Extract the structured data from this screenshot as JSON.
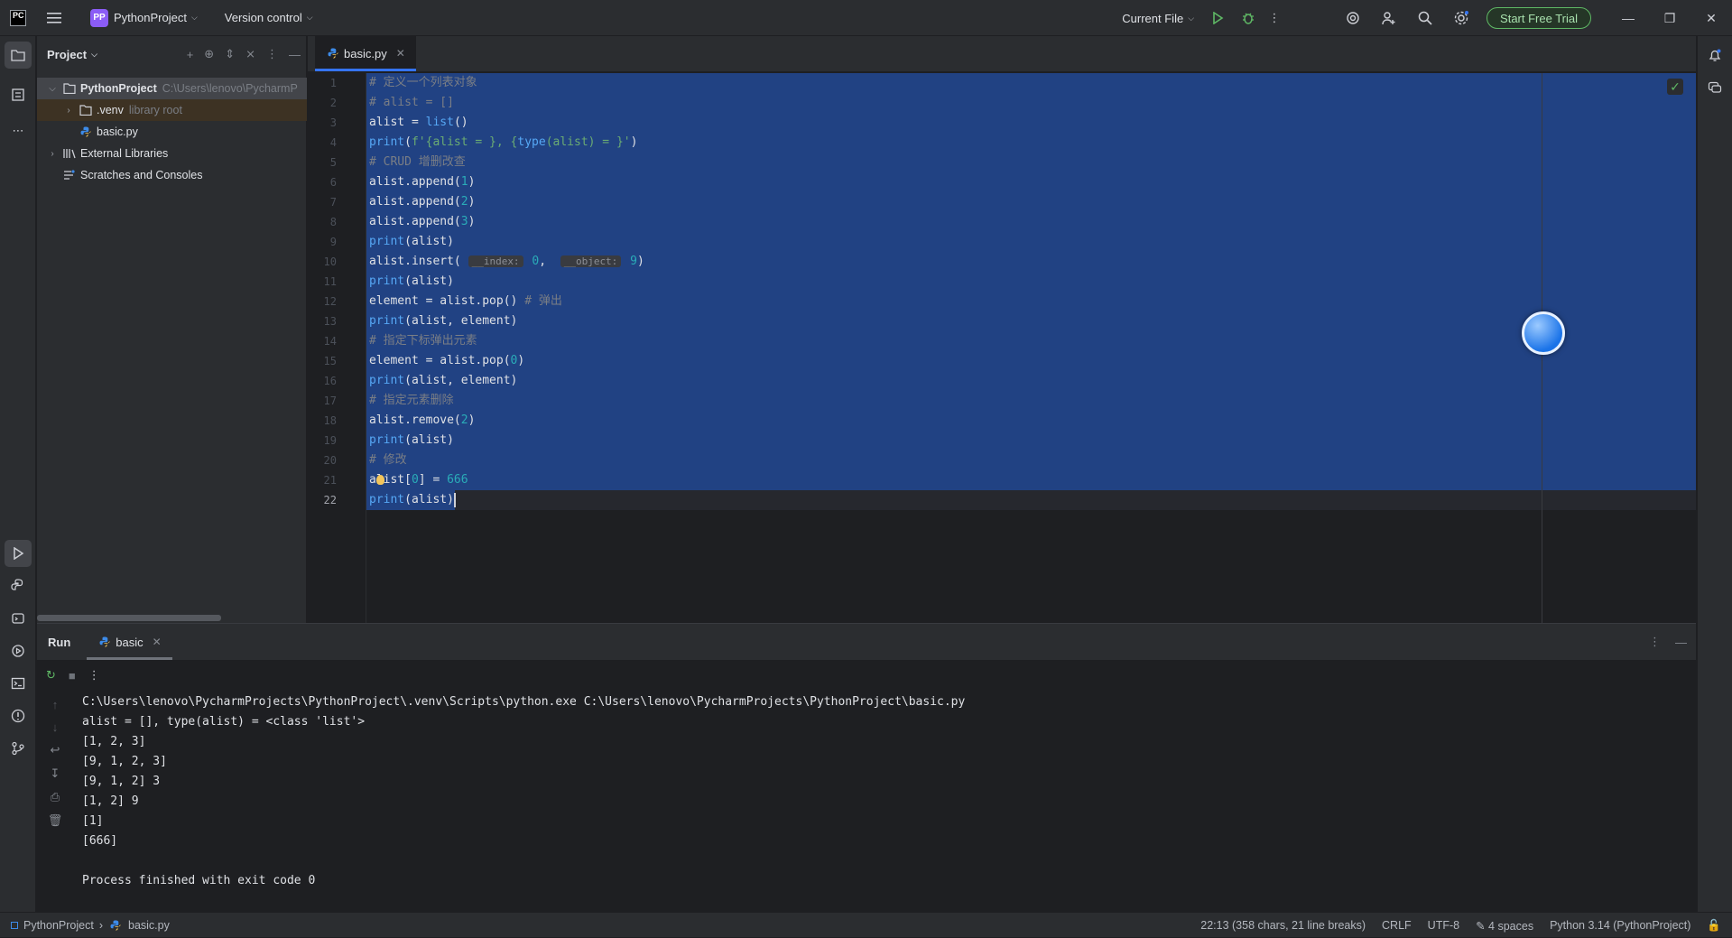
{
  "titlebar": {
    "app_logo": "PC",
    "project_badge": "PP",
    "project_name": "PythonProject",
    "vcs_label": "Version control",
    "run_config": "Current File",
    "trial_button": "Start Free Trial"
  },
  "project_pane": {
    "title": "Project",
    "tree": [
      {
        "label": "PythonProject",
        "hint": "C:\\Users\\lenovo\\PycharmP",
        "icon": "folder-icon",
        "indent": 0,
        "expanded": true
      },
      {
        "label": ".venv",
        "hint": "library root",
        "icon": "folder-icon",
        "indent": 1,
        "expanded": false
      },
      {
        "label": "basic.py",
        "hint": "",
        "icon": "python-file-icon",
        "indent": 1
      },
      {
        "label": "External Libraries",
        "hint": "",
        "icon": "library-icon",
        "indent": 0,
        "expanded": false
      },
      {
        "label": "Scratches and Consoles",
        "hint": "",
        "icon": "scratches-icon",
        "indent": 0
      }
    ]
  },
  "editor": {
    "tab_label": "basic.py",
    "current_line": 22,
    "lines": [
      "# 定义一个列表对象",
      "# alist = []",
      "alist = list()",
      "print(f'{alist = }, {type(alist) = }')",
      "# CRUD 增删改查",
      "alist.append(1)",
      "alist.append(2)",
      "alist.append(3)",
      "print(alist)",
      "alist.insert( __index: 0,  __object: 9)",
      "print(alist)",
      "element = alist.pop() # 弹出",
      "print(alist, element)",
      "# 指定下标弹出元素",
      "element = alist.pop(0)",
      "print(alist, element)",
      "# 指定元素删除",
      "alist.remove(2)",
      "print(alist)",
      "# 修改",
      "alist[0] = 666",
      "print(alist)"
    ],
    "inlay_index": "__index:",
    "inlay_object": "__object:"
  },
  "run_window": {
    "title": "Run",
    "tab_label": "basic",
    "console": [
      "C:\\Users\\lenovo\\PycharmProjects\\PythonProject\\.venv\\Scripts\\python.exe C:\\Users\\lenovo\\PycharmProjects\\PythonProject\\basic.py",
      "alist = [], type(alist) = <class 'list'>",
      "[1, 2, 3]",
      "[9, 1, 2, 3]",
      "[9, 1, 2] 3",
      "[1, 2] 9",
      "[1]",
      "[666]",
      "",
      "Process finished with exit code 0"
    ]
  },
  "statusbar": {
    "crumb_project": "PythonProject",
    "crumb_file": "basic.py",
    "position": "22:13 (358 chars, 21 line breaks)",
    "line_sep": "CRLF",
    "encoding": "UTF-8",
    "indent": "4 spaces",
    "interpreter": "Python 3.14 (PythonProject)"
  },
  "colors": {
    "selection": "#214283",
    "accent": "#3574f0",
    "trial_green": "#5fb865"
  }
}
